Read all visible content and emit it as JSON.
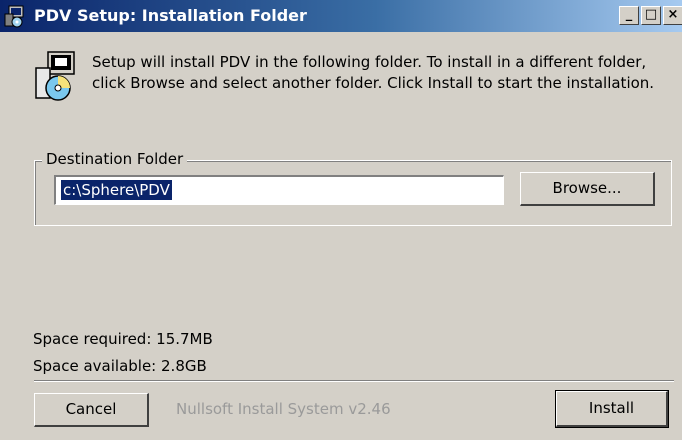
{
  "window": {
    "title": "PDV Setup: Installation Folder",
    "buttons": {
      "minimize": "_",
      "maximize": "□",
      "close": "×"
    }
  },
  "header": {
    "text": "Setup will install PDV in the following folder. To install in a different folder, click Browse and select another folder. Click Install to start the installation.",
    "icon": "installer-icon"
  },
  "destination": {
    "group_label": "Destination Folder",
    "path": "c:\\Sphere\\PDV",
    "browse_label": "Browse..."
  },
  "space": {
    "required": "Space required: 15.7MB",
    "available": "Space available: 2.8GB"
  },
  "footer": {
    "cancel_label": "Cancel",
    "branding": "Nullsoft Install System v2.46",
    "install_label": "Install"
  },
  "colors": {
    "title_gradient_start": "#0a246a",
    "title_gradient_end": "#a6caf0",
    "face": "#d4d0c8",
    "selection": "#0a246a"
  }
}
